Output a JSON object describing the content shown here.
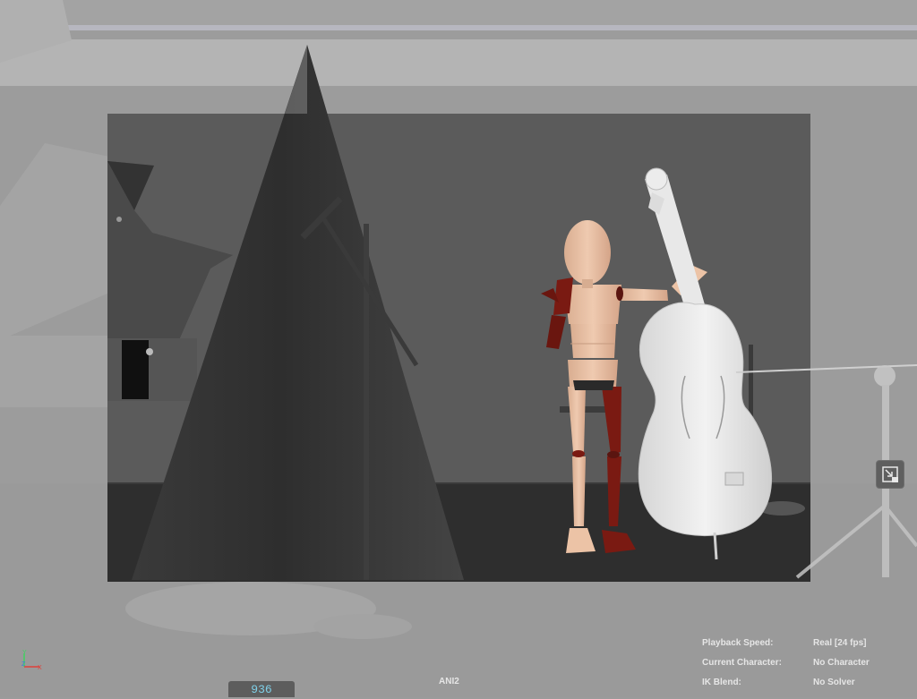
{
  "hud": {
    "playback_speed_label": "Playback Speed:",
    "playback_speed_value": "Real [24 fps]",
    "current_character_label": "Current Character:",
    "current_character_value": "No Character",
    "ik_blend_label": "IK Blend:",
    "ik_blend_value": "No Solver"
  },
  "timeline": {
    "current_frame": "936"
  },
  "camera": {
    "name": "ANI2"
  },
  "axis": {
    "y": "Y",
    "z": "Z",
    "x": "X"
  },
  "colors": {
    "frame_counter_text": "#7fd0e8",
    "hud_text": "#e6e6e6",
    "axis_y": "#3fd35f",
    "axis_x": "#e0403a",
    "axis_z": "#3a7be0",
    "figure_skin": "#e9c1a6",
    "figure_selected": "#7a1a12"
  },
  "icons": {
    "pip_button": "picture-in-picture-icon",
    "axis": "view-axis-icon"
  }
}
